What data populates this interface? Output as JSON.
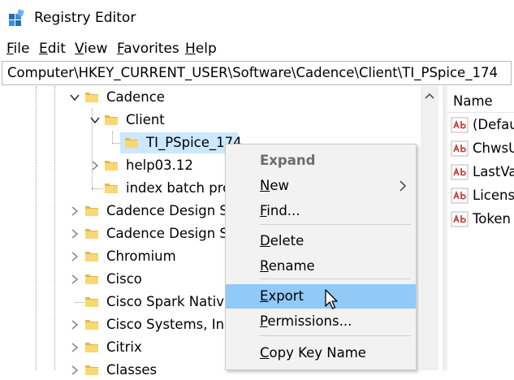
{
  "window": {
    "title": "Registry Editor"
  },
  "menu": [
    "File",
    "Edit",
    "View",
    "Favorites",
    "Help"
  ],
  "address": "Computer\\HKEY_CURRENT_USER\\Software\\Cadence\\Client\\TI_PSpice_174",
  "tree": {
    "items": [
      {
        "label": "Cadence",
        "expander": "expanded"
      },
      {
        "label": "Client",
        "expander": "expanded"
      },
      {
        "label": "TI_PSpice_174",
        "expander": "none",
        "selected": true
      },
      {
        "label": "help03.12",
        "expander": "collapsed"
      },
      {
        "label": "index batch pro",
        "expander": "none"
      },
      {
        "label": "Cadence Design Sy",
        "expander": "collapsed"
      },
      {
        "label": "Cadence Design Sy",
        "expander": "collapsed"
      },
      {
        "label": "Chromium",
        "expander": "collapsed"
      },
      {
        "label": "Cisco",
        "expander": "collapsed"
      },
      {
        "label": "Cisco Spark Native",
        "expander": "none"
      },
      {
        "label": "Cisco Systems, Inc",
        "expander": "collapsed"
      },
      {
        "label": "Citrix",
        "expander": "collapsed"
      },
      {
        "label": "Classes",
        "expander": "collapsed"
      }
    ]
  },
  "values_pane": {
    "column_name": "Name",
    "values": [
      "(Defau",
      "ChwsU",
      "LastVa",
      "License",
      "Token"
    ]
  },
  "context_menu": {
    "items": [
      {
        "label": "Expand",
        "bold": true
      },
      {
        "label": "New",
        "submenu": true
      },
      {
        "label": "Find..."
      },
      {
        "label": "Delete"
      },
      {
        "label": "Rename"
      },
      {
        "label": "Export",
        "highlighted": true
      },
      {
        "label": "Permissions..."
      },
      {
        "label": "Copy Key Name"
      }
    ]
  },
  "colors": {
    "selection": "#cce8ff",
    "menu_highlight": "#91c9f7",
    "folder": "#f8d775",
    "app_icon": "#1f6fb5"
  }
}
